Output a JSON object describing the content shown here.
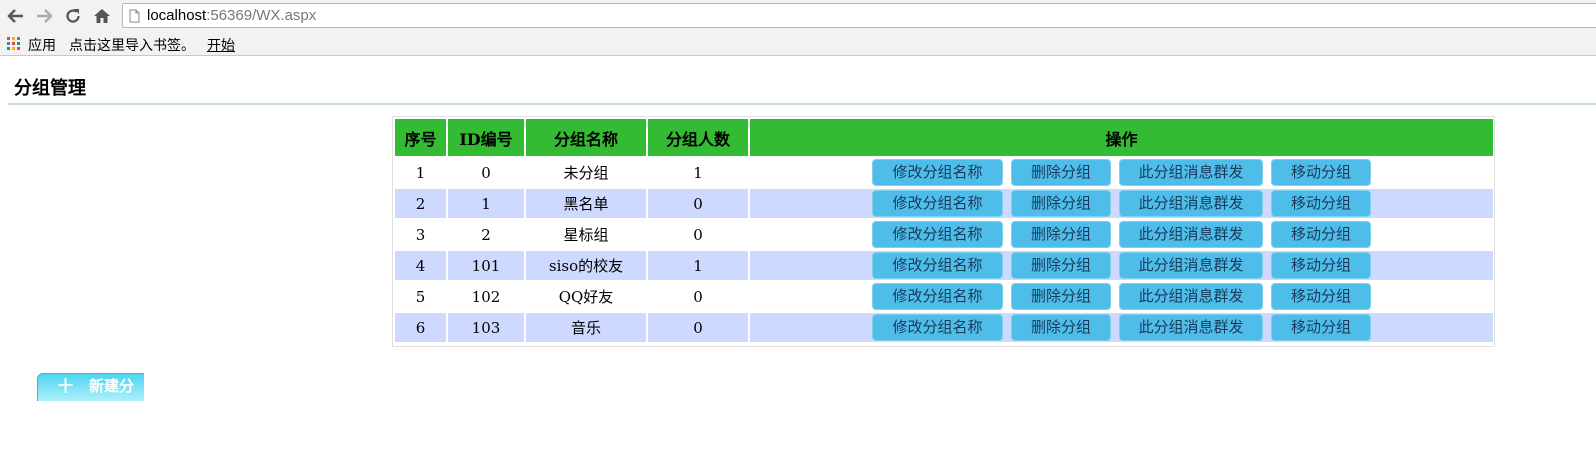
{
  "browser": {
    "url_host": "localhost",
    "url_rest": ":56369/WX.aspx",
    "bookmarks": {
      "apps_label": "应用",
      "import_hint": "点击这里导入书签。",
      "start_link": "开始"
    }
  },
  "page": {
    "title": "分组管理"
  },
  "table": {
    "headers": {
      "index": "序号",
      "id": "ID编号",
      "name": "分组名称",
      "count": "分组人数",
      "actions": "操作"
    },
    "actions": {
      "rename": "修改分组名称",
      "delete": "删除分组",
      "broadcast": "此分组消息群发",
      "move": "移动分组"
    },
    "rows": [
      {
        "index": "1",
        "id": "0",
        "name": "未分组",
        "count": "1"
      },
      {
        "index": "2",
        "id": "1",
        "name": "黑名单",
        "count": "0"
      },
      {
        "index": "3",
        "id": "2",
        "name": "星标组",
        "count": "0"
      },
      {
        "index": "4",
        "id": "101",
        "name": "siso的校友",
        "count": "1"
      },
      {
        "index": "5",
        "id": "102",
        "name": "QQ好友",
        "count": "0"
      },
      {
        "index": "6",
        "id": "103",
        "name": "音乐",
        "count": "0"
      }
    ]
  },
  "new_group_tab": {
    "plus": "十",
    "label": "新建分"
  },
  "colors": {
    "header_green": "#33bb33",
    "alt_row": "#cdd9ff",
    "button_blue": "#4fbdea"
  }
}
